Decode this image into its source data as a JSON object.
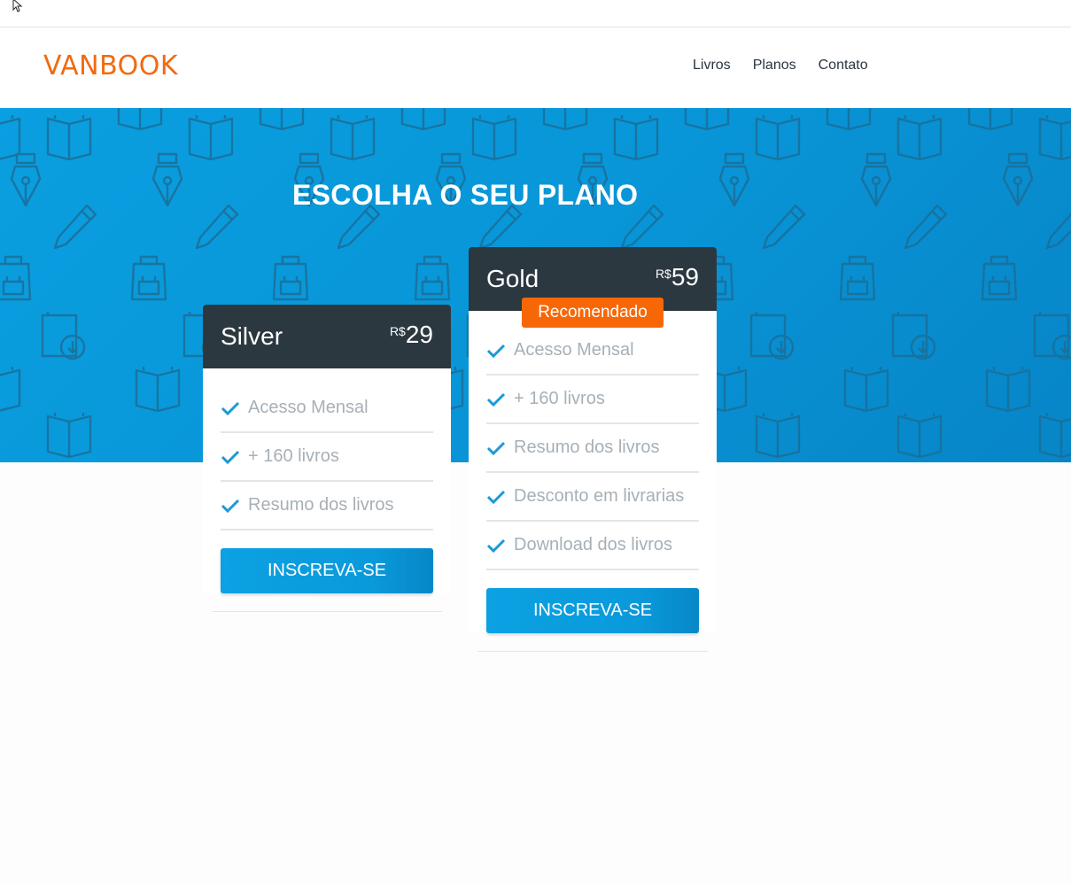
{
  "header": {
    "logo": "VANBOOK",
    "nav": [
      "Livros",
      "Planos",
      "Contato"
    ]
  },
  "hero": {
    "title": "ESCOLHA O SEU PLANO"
  },
  "plans": [
    {
      "name": "Silver",
      "currency": "R$",
      "price": "29",
      "features": [
        "Acesso Mensal",
        "+ 160 livros",
        "Resumo dos livros"
      ],
      "button": "INSCREVA-SE"
    },
    {
      "name": "Gold",
      "currency": "R$",
      "price": "59",
      "badge": "Recomendado",
      "features": [
        "Acesso Mensal",
        "+ 160 livros",
        "Resumo dos livros",
        "Desconto em livrarias",
        "Download dos livros"
      ],
      "button": "INSCREVA-SE"
    }
  ],
  "colors": {
    "brand_orange": "#f26a10",
    "hero_blue": "#0896d8",
    "card_header": "#2c3840",
    "badge_orange": "#f86706",
    "check_blue": "#1a9ad6"
  },
  "icons": [
    "cursor-icon",
    "book-icon",
    "pen-nib-icon",
    "pencil-icon",
    "backpack-icon",
    "ebook-download-icon",
    "check-icon"
  ]
}
